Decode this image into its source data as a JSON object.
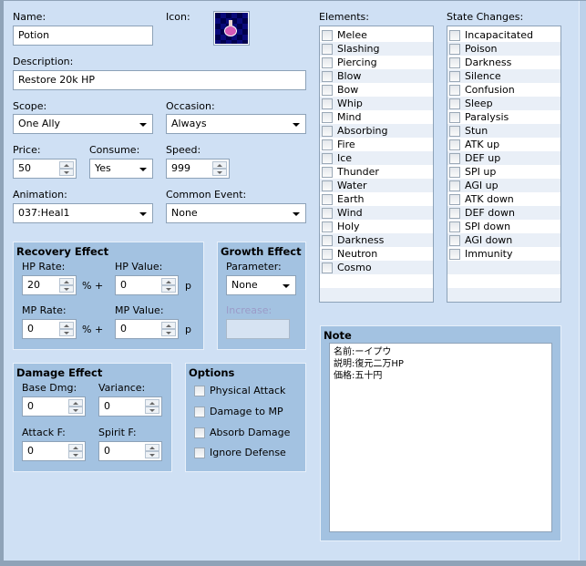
{
  "name": {
    "label": "Name:",
    "value": "Potion"
  },
  "icon": {
    "label": "Icon:",
    "name": "potion-icon"
  },
  "description": {
    "label": "Description:",
    "value": "Restore 20k HP"
  },
  "scope": {
    "label": "Scope:",
    "value": "One Ally"
  },
  "occasion": {
    "label": "Occasion:",
    "value": "Always"
  },
  "price": {
    "label": "Price:",
    "value": "50"
  },
  "consume": {
    "label": "Consume:",
    "value": "Yes"
  },
  "speed": {
    "label": "Speed:",
    "value": "999"
  },
  "animation": {
    "label": "Animation:",
    "value": "037:Heal1"
  },
  "common_event": {
    "label": "Common Event:",
    "value": "None"
  },
  "recovery": {
    "title": "Recovery Effect",
    "hp_rate_label": "HP Rate:",
    "hp_rate": "20",
    "hp_value_label": "HP Value:",
    "hp_value": "0",
    "mp_rate_label": "MP Rate:",
    "mp_rate": "0",
    "mp_value_label": "MP Value:",
    "mp_value": "0",
    "pct_plus": "% +",
    "p": "p"
  },
  "growth": {
    "title": "Growth Effect",
    "parameter_label": "Parameter:",
    "parameter": "None",
    "increase_label": "Increase:"
  },
  "damage": {
    "title": "Damage Effect",
    "base_label": "Base Dmg:",
    "base": "0",
    "variance_label": "Variance:",
    "variance": "0",
    "attack_label": "Attack F:",
    "attack": "0",
    "spirit_label": "Spirit F:",
    "spirit": "0"
  },
  "options": {
    "title": "Options",
    "items": [
      "Physical Attack",
      "Damage to MP",
      "Absorb Damage",
      "Ignore Defense"
    ]
  },
  "elements": {
    "label": "Elements:",
    "items": [
      "Melee",
      "Slashing",
      "Piercing",
      "Blow",
      "Bow",
      "Whip",
      "Mind",
      "Absorbing",
      "Fire",
      "Ice",
      "Thunder",
      "Water",
      "Earth",
      "Wind",
      "Holy",
      "Darkness",
      "Neutron",
      "Cosmo"
    ]
  },
  "states": {
    "label": "State Changes:",
    "items": [
      "Incapacitated",
      "Poison",
      "Darkness",
      "Silence",
      "Confusion",
      "Sleep",
      "Paralysis",
      "Stun",
      "ATK up",
      "DEF up",
      "SPI up",
      "AGI up",
      "ATK down",
      "DEF down",
      "SPI down",
      "AGI down",
      "Immunity"
    ]
  },
  "note": {
    "title": "Note",
    "lines": [
      "名前:ーイプウ",
      "説明:復元二万HP",
      "価格:五十円"
    ]
  }
}
